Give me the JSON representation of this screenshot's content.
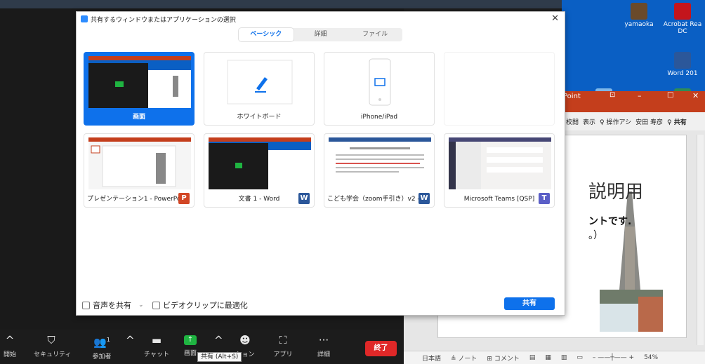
{
  "desktop": {
    "icons": [
      {
        "label": "yamaoka",
        "color": "#6a4a2a"
      },
      {
        "label": "Acrobat Rea DC",
        "color": "#c4151c"
      },
      {
        "label": "Word 201",
        "color": "#2b579a"
      },
      {
        "label": "",
        "color": "#2e8b57"
      }
    ]
  },
  "powerpoint": {
    "title_suffix": "Point",
    "ribbon": [
      "校閲",
      "表示",
      "♀ 操作アシ",
      "安田 寿彦",
      "♀ 共有"
    ],
    "slide": {
      "title": "説明用",
      "line1": "ントです.",
      "line2": "。）"
    },
    "status": [
      "日本語",
      "≜ ノート",
      "⊞ コメント",
      "54%"
    ]
  },
  "toolbar": {
    "items": [
      {
        "label": "開始",
        "icon": "chevron-up"
      },
      {
        "label": "セキュリティ",
        "icon": "shield"
      },
      {
        "label": "参加者",
        "icon": "participants",
        "count": "1"
      },
      {
        "label": "チャット",
        "icon": "chat"
      },
      {
        "label": "画面",
        "icon": "share-screen"
      },
      {
        "label": "ション",
        "icon": "reaction"
      },
      {
        "label": "アプリ",
        "icon": "apps"
      },
      {
        "label": "詳細",
        "icon": "more"
      }
    ],
    "end_label": "終了",
    "tooltip": "共有 (Alt+S)"
  },
  "dialog": {
    "title": "共有するウィンドウまたはアプリケーションの選択",
    "tabs": [
      "ベーシック",
      "詳細",
      "ファイル"
    ],
    "tiles": [
      {
        "label": "画面",
        "selected": true
      },
      {
        "label": "ホワイトボード",
        "selected": false
      },
      {
        "label": "iPhone/iPad",
        "selected": false
      },
      {
        "label": "",
        "selected": false
      },
      {
        "label": "プレゼンテーション1 - PowerPoint",
        "badge": "P",
        "badge_color": "#d24726"
      },
      {
        "label": "文書 1 - Word",
        "badge": "W",
        "badge_color": "#2b579a"
      },
      {
        "label": "こども学会（zoom手引き）v2 - ...",
        "badge": "W",
        "badge_color": "#2b579a"
      },
      {
        "label": "Microsoft Teams [QSP]",
        "badge": "T",
        "badge_color": "#5b5fc7"
      }
    ],
    "footer": {
      "share_audio": "音声を共有",
      "optimize_video": "ビデオクリップに最適化",
      "share_button": "共有"
    }
  }
}
